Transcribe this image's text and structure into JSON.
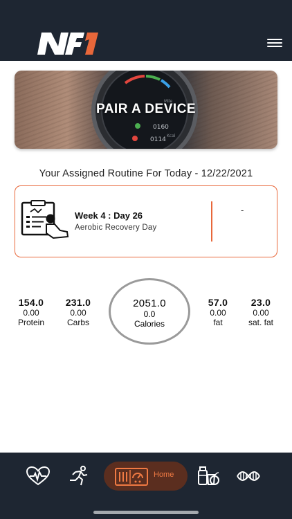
{
  "header": {
    "logo_text": "NF1",
    "menu_icon": "hamburger-menu-icon"
  },
  "device_banner": {
    "title": "PAIR A DEVICE"
  },
  "routine": {
    "heading": "Your Assigned Routine For Today - 12/22/2021",
    "week_day": "Week 4 : Day 26",
    "description": "Aerobic Recovery Day",
    "status": "-"
  },
  "macros": {
    "protein": {
      "target": "154.0",
      "value": "0.00",
      "label": "Protein"
    },
    "carbs": {
      "target": "231.0",
      "value": "0.00",
      "label": "Carbs"
    },
    "calories": {
      "target": "2051.0",
      "value": "0.0",
      "label": "Calories"
    },
    "fat": {
      "target": "57.0",
      "value": "0.00",
      "label": "fat"
    },
    "sat_fat": {
      "target": "23.0",
      "value": "0.00",
      "label": "sat. fat"
    }
  },
  "tabbar": {
    "items": [
      {
        "name": "heart-rate",
        "icon": "heart-rate-icon"
      },
      {
        "name": "workout",
        "icon": "running-person-icon"
      },
      {
        "name": "home",
        "icon": "dashboard-icon",
        "label": "Home",
        "active": true
      },
      {
        "name": "nutrition",
        "icon": "groceries-icon"
      },
      {
        "name": "dna",
        "icon": "dna-icon"
      }
    ]
  },
  "colors": {
    "header_bg": "#1e2632",
    "accent": "#e8673a",
    "home_pill": "#5b2e1f"
  }
}
